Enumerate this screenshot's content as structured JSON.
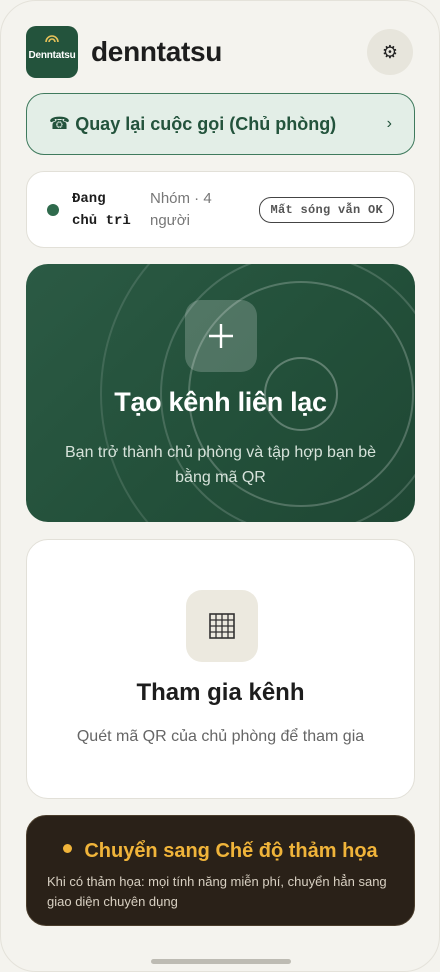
{
  "header": {
    "logo_text": "Denntatsu",
    "app_title": "denntatsu",
    "settings_icon": "gear-icon"
  },
  "return_call": {
    "icon": "phone-icon",
    "label": "Quay lại cuộc gọi (Chủ phòng)",
    "chevron": "›"
  },
  "status": {
    "host_line1": "Đang",
    "host_line2": "chủ trì",
    "group_line1": "Nhóm · 4",
    "group_line2": "người",
    "signal_badge": "Mất sóng vẫn OK",
    "dot_color": "#2f6a4c"
  },
  "create_channel": {
    "icon": "plus-icon",
    "title": "Tạo kênh liên lạc",
    "subtitle": "Bạn trở thành chủ phòng và tập hợp bạn bè bằng mã QR"
  },
  "join_channel": {
    "icon": "qr-grid-icon",
    "title": "Tham gia kênh",
    "subtitle": "Quét mã QR của chủ phòng để tham gia"
  },
  "disaster_mode": {
    "title": "Chuyển sang Chế độ thảm họa",
    "subtitle": "Khi có thảm họa: mọi tính năng miễn phí, chuyển hẳn sang giao diện chuyên dụng",
    "accent_color": "#f0b43a"
  },
  "colors": {
    "brand_green": "#23533c",
    "background": "#f4f3ee",
    "disaster_bg": "#2a2118"
  }
}
